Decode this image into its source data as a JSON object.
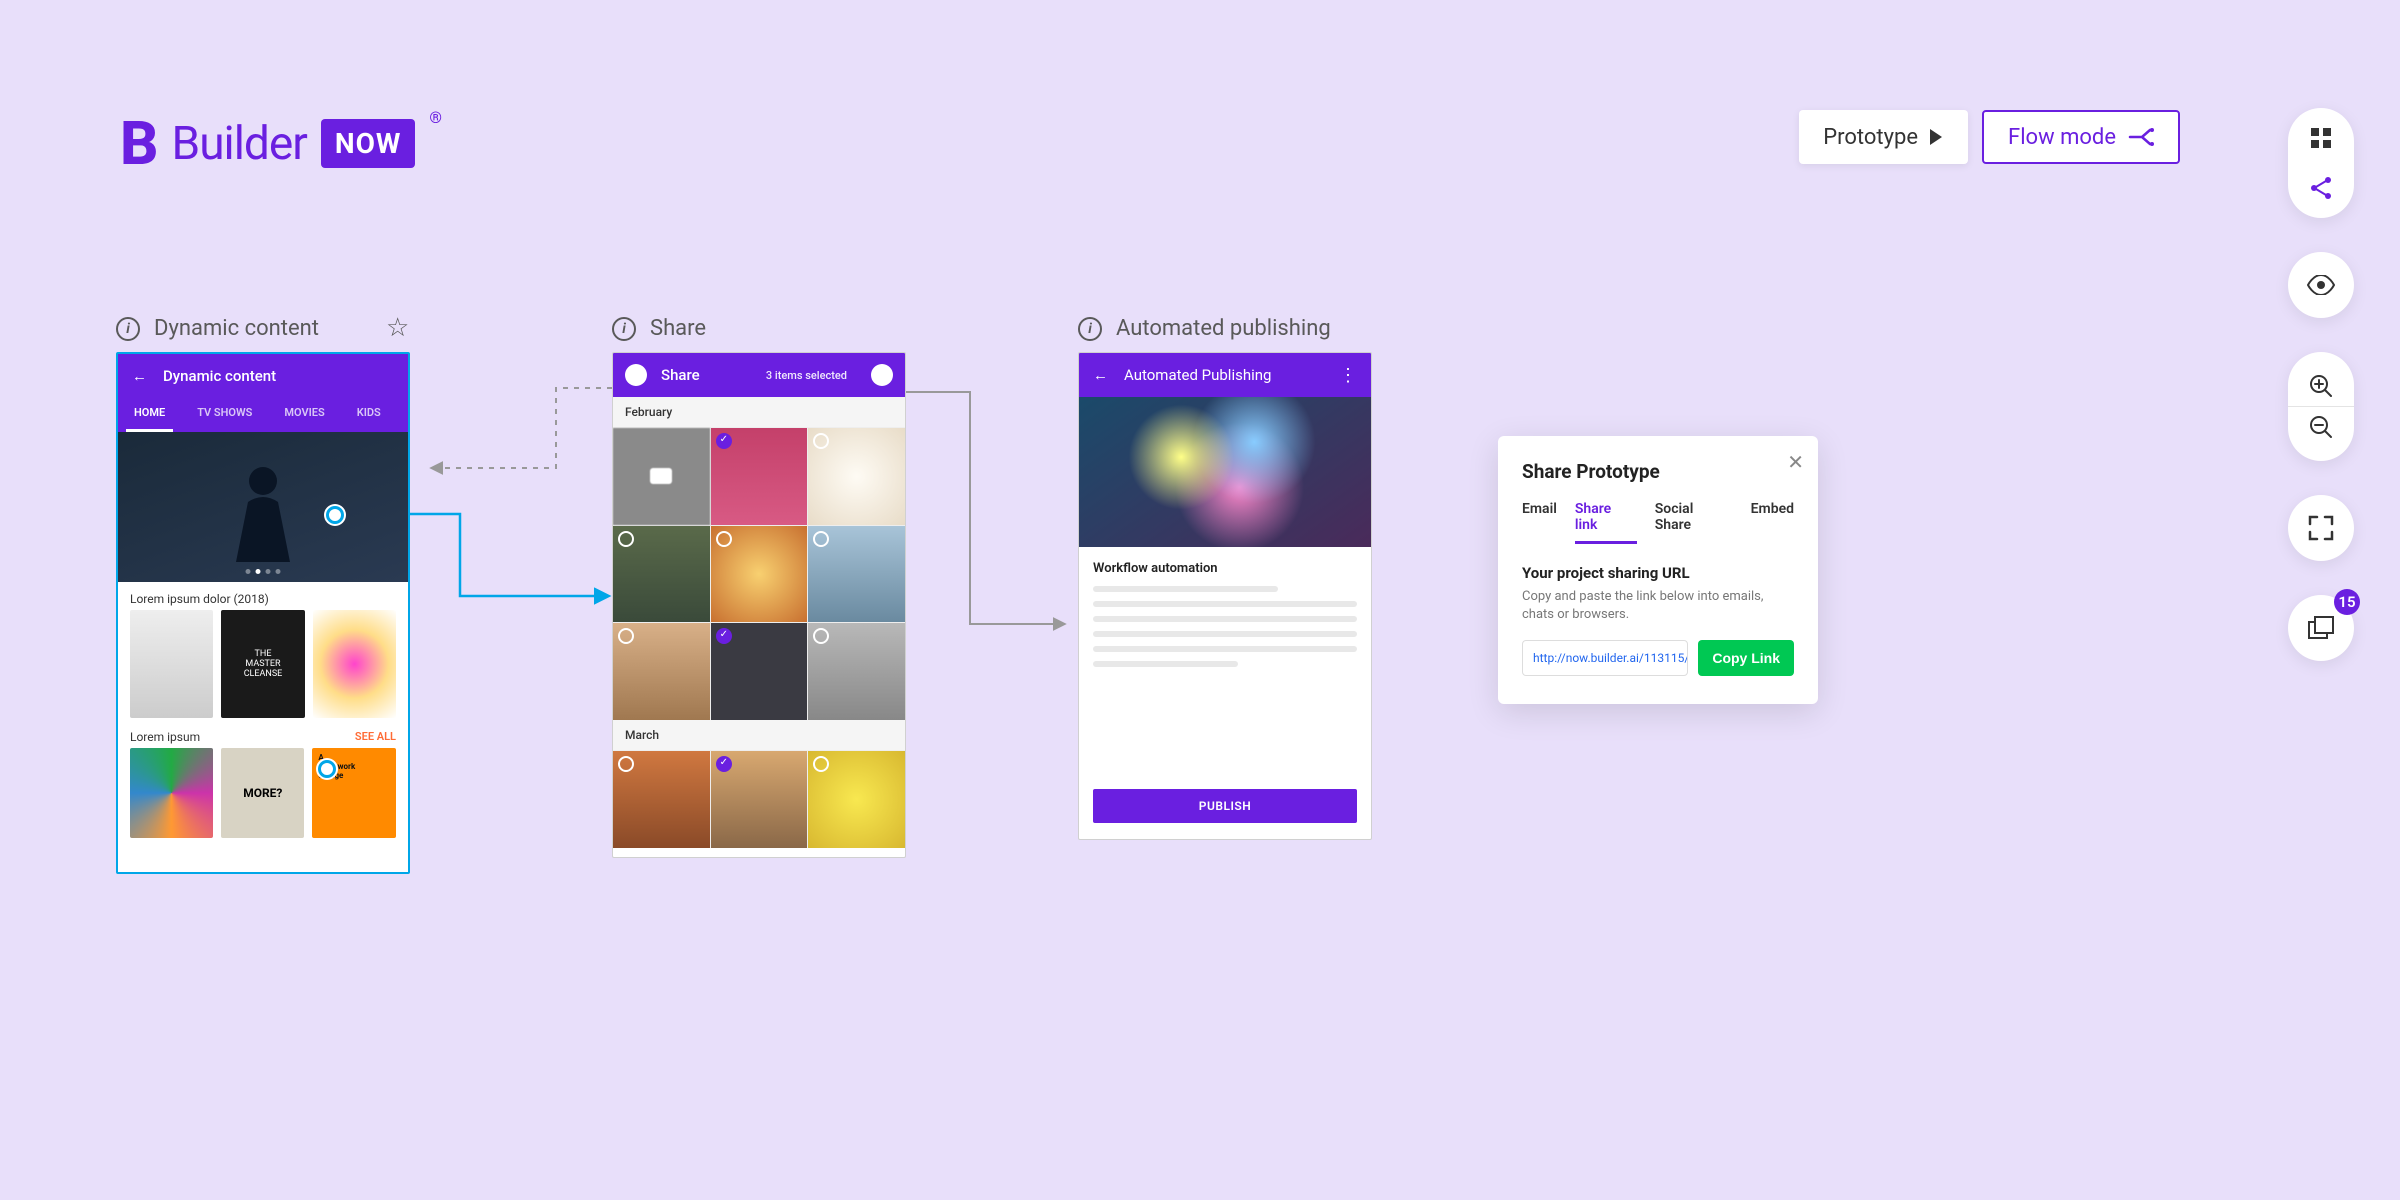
{
  "brand": {
    "name": "Builder",
    "sub": "NOW",
    "registered": "®"
  },
  "modes": {
    "prototype": "Prototype",
    "flow": "Flow mode"
  },
  "rail": {
    "pages_count": "15"
  },
  "screens": {
    "dynamic": {
      "label": "Dynamic content",
      "header_title": "Dynamic content",
      "tabs": [
        "HOME",
        "TV SHOWS",
        "MOVIES",
        "KIDS"
      ],
      "caption1": "Lorem ipsum dolor (2018)",
      "caption2": "Lorem ipsum",
      "see_all": "SEE ALL"
    },
    "share": {
      "label": "Share",
      "header_title": "Share",
      "selected_text": "3 items selected",
      "month1": "February",
      "month2": "March"
    },
    "auto": {
      "label": "Automated publishing",
      "header_title": "Automated Publishing",
      "section_title": "Workflow automation",
      "publish_button": "PUBLISH"
    }
  },
  "share_panel": {
    "title": "Share Prototype",
    "tabs": {
      "email": "Email",
      "link": "Share link",
      "social": "Social Share",
      "embed": "Embed"
    },
    "subhead": "Your project sharing URL",
    "desc": "Copy and paste the link below into emails, chats or browsers.",
    "url": "http://now.builder.ai/113115/",
    "copy": "Copy Link"
  }
}
